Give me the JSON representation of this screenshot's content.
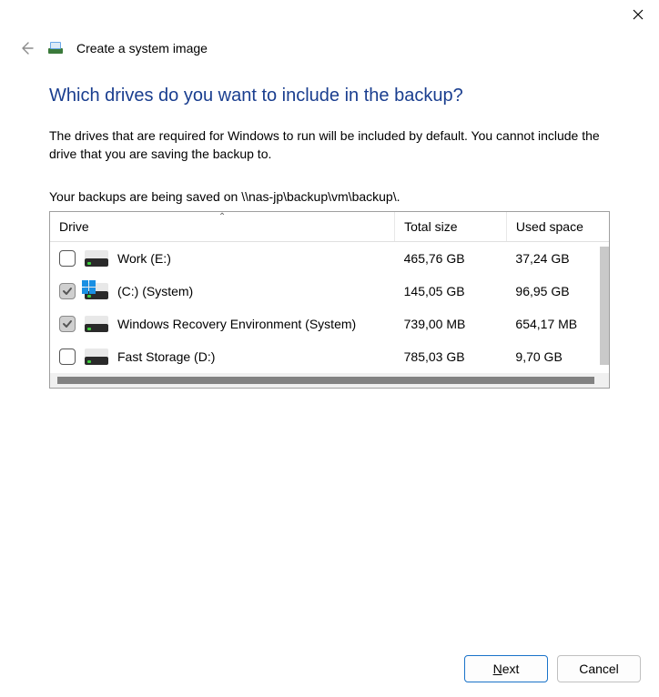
{
  "window": {
    "title": "Create a system image"
  },
  "main": {
    "heading": "Which drives do you want to include in the backup?",
    "description": "The drives that are required for Windows to run will be included by default. You cannot include the drive that you are saving the backup to.",
    "save_location_line": "Your backups are being saved on \\\\nas-jp\\backup\\vm\\backup\\."
  },
  "table": {
    "headers": {
      "drive": "Drive",
      "total": "Total size",
      "used": "Used space"
    },
    "rows": [
      {
        "checked": false,
        "disabled": false,
        "win": false,
        "name": "Work (E:)",
        "total": "465,76 GB",
        "used": "37,24 GB"
      },
      {
        "checked": true,
        "disabled": true,
        "win": true,
        "name": "(C:) (System)",
        "total": "145,05 GB",
        "used": "96,95 GB"
      },
      {
        "checked": true,
        "disabled": true,
        "win": false,
        "name": "Windows Recovery Environment (System)",
        "total": "739,00 MB",
        "used": "654,17 MB"
      },
      {
        "checked": false,
        "disabled": false,
        "win": false,
        "name": "Fast Storage (D:)",
        "total": "785,03 GB",
        "used": "9,70 GB"
      }
    ]
  },
  "footer": {
    "next": "Next",
    "cancel": "Cancel"
  }
}
